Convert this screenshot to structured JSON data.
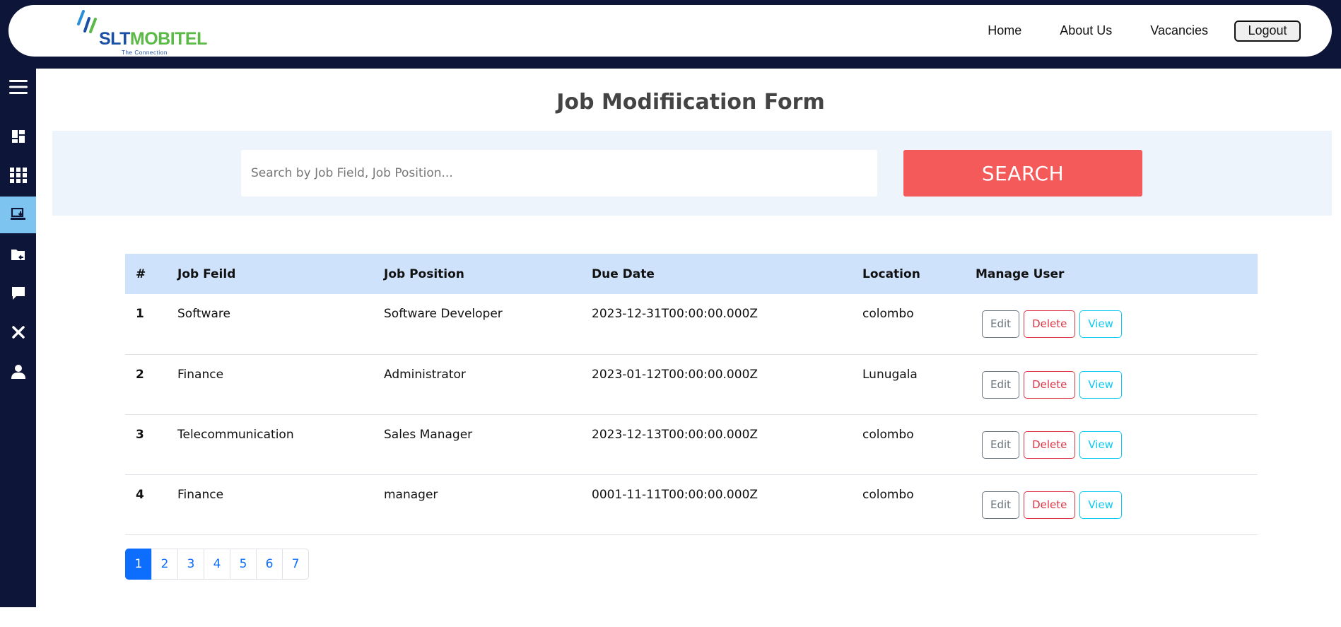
{
  "navbar": {
    "logo": {
      "brand_primary": "SLT",
      "brand_secondary": "MOBITEL",
      "tagline": "The Connection"
    },
    "links": [
      "Home",
      "About Us",
      "Vacancies"
    ],
    "logout_label": "Logout"
  },
  "sidebar": {
    "items": [
      {
        "icon": "menu-icon"
      },
      {
        "icon": "dashboard-icon"
      },
      {
        "icon": "grid-icon"
      },
      {
        "icon": "laptop-download-icon",
        "active": true
      },
      {
        "icon": "folder-return-icon"
      },
      {
        "icon": "message-icon"
      },
      {
        "icon": "close-icon"
      },
      {
        "icon": "user-icon"
      }
    ]
  },
  "page": {
    "title": "Job Modifiication Form"
  },
  "search": {
    "placeholder": "Search by Job Field, Job Position...",
    "value": "",
    "button_label": "SEARCH"
  },
  "table": {
    "headers": [
      "#",
      "Job Feild",
      "Job Position",
      "Due Date",
      "Location",
      "Manage User"
    ],
    "rows": [
      {
        "num": "1",
        "field": "Software",
        "position": "Software Developer",
        "due": "2023-12-31T00:00:00.000Z",
        "location": "colombo"
      },
      {
        "num": "2",
        "field": "Finance",
        "position": "Administrator",
        "due": "2023-01-12T00:00:00.000Z",
        "location": "Lunugala"
      },
      {
        "num": "3",
        "field": "Telecommunication",
        "position": "Sales Manager",
        "due": "2023-12-13T00:00:00.000Z",
        "location": "colombo"
      },
      {
        "num": "4",
        "field": "Finance",
        "position": "manager",
        "due": "0001-11-11T00:00:00.000Z",
        "location": "colombo"
      }
    ],
    "actions": {
      "edit": "Edit",
      "delete": "Delete",
      "view": "View"
    }
  },
  "pagination": {
    "pages": [
      "1",
      "2",
      "3",
      "4",
      "5",
      "6",
      "7"
    ],
    "current": "1"
  },
  "colors": {
    "navy": "#0d1538",
    "active_sidebar": "#7ec4f0",
    "search_button": "#f45a5a",
    "header_row": "#cfe2fb",
    "search_panel": "#eef4fc",
    "primary": "#0d6efd"
  }
}
